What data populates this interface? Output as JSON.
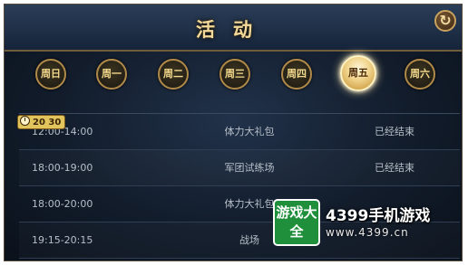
{
  "header": {
    "title": "活动"
  },
  "weekdays": [
    "周日",
    "周一",
    "周二",
    "周三",
    "周四",
    "周五",
    "周六"
  ],
  "selected_weekday": "周五",
  "current_timer": "20 30",
  "activities": [
    {
      "time": "12:00-14:00",
      "name": "体力大礼包",
      "status": "已经结束"
    },
    {
      "time": "18:00-19:00",
      "name": "军团试练场",
      "status": "已经结束"
    },
    {
      "time": "18:00-20:00",
      "name": "体力大礼包",
      "status": ""
    },
    {
      "time": "19:15-20:15",
      "name": "战场",
      "status": ""
    }
  ],
  "watermark": {
    "badge": "游戏大全",
    "site": "4399手机游戏",
    "url": "www.4399.cn"
  },
  "colors": {
    "accent_gold": "#f2d99a",
    "selected_day": "#f2d690",
    "text": "#b7bfc9"
  }
}
